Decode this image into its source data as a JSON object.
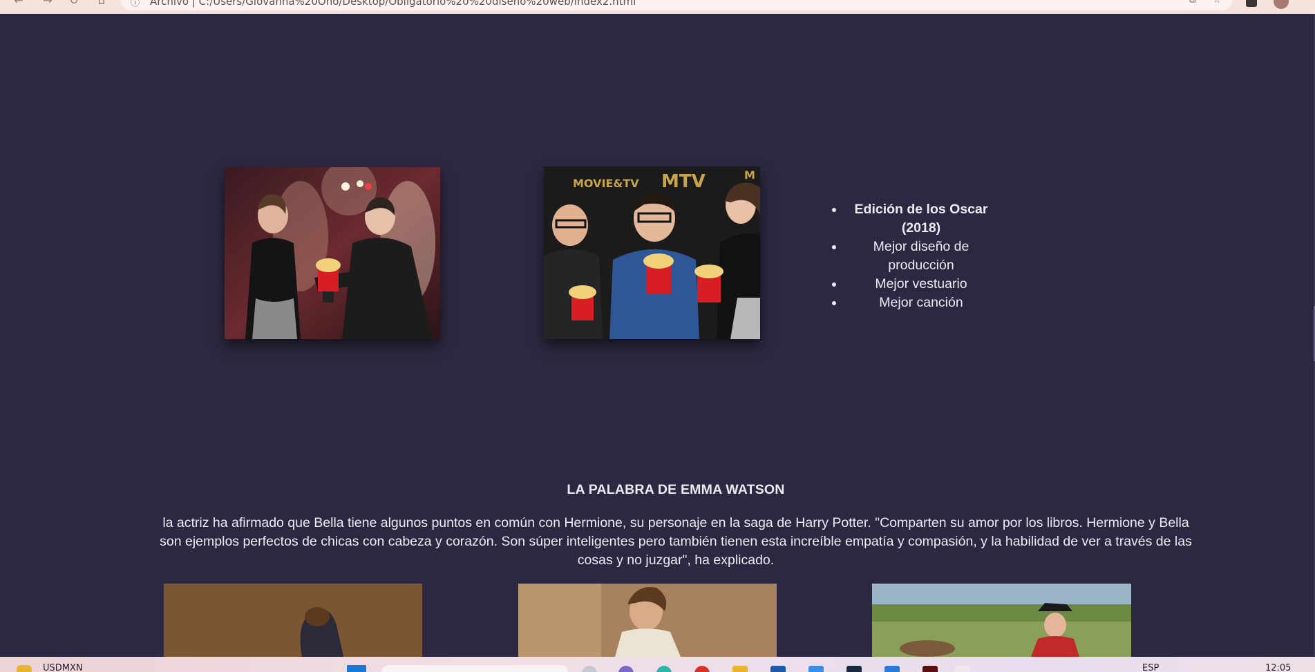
{
  "browser": {
    "address_text": "Archivo  |  C:/Users/Giovanna%20Ono/Desktop/Obligatorio%20%20diseño%20web/index2.html",
    "back_icon": "arrow-left-icon",
    "forward_icon": "arrow-right-icon",
    "reload_icon": "reload-icon",
    "star_icon": "star-icon"
  },
  "awards": {
    "items": [
      {
        "label": "Edición de los Oscar (2018)",
        "bold": true
      },
      {
        "label": "Mejor diseño de producción",
        "bold": false
      },
      {
        "label": "Mejor vestuario",
        "bold": false
      },
      {
        "label": "Mejor canción",
        "bold": false
      }
    ]
  },
  "quote_section": {
    "title": "LA PALABRA DE EMMA WATSON",
    "text": "la actriz ha afirmado que Bella tiene algunos puntos en común con Hermione, su personaje en la saga de Harry Potter. \"Comparten su amor por los libros. Hermione y Bella son ejemplos perfectos de chicas con cabeza y corazón. Son súper inteligentes pero también tienen esta increíble empatía y compasión, y la habilidad de ver a través de las cosas y no juzgar\", ha explicado."
  },
  "taskbar": {
    "ticker": "USDMXN",
    "language": "ESP",
    "time": "12:05"
  },
  "colors": {
    "page_bg": "#2d2842",
    "text": "#ecebf2"
  }
}
